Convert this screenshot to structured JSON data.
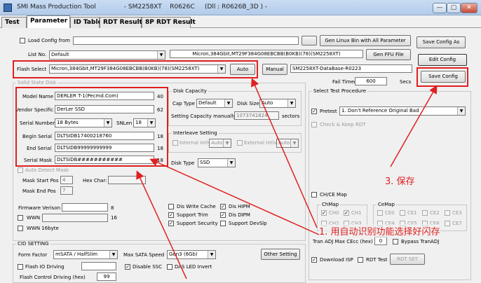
{
  "window": {
    "title": "SMI Mass Production Tool              - SM2258XT    R0626C     (Dll : R0626B_3D ) -",
    "buttons": [
      "—",
      "▢",
      "✕"
    ]
  },
  "tabs": [
    "Test",
    "Parameter",
    "ID Table",
    "RDT Result",
    "8P RDT Result"
  ],
  "top": {
    "load_config_label": "Load Config from",
    "list_no_label": "List No.",
    "list_no_value": "Default",
    "flash_select_label": "Flash Select",
    "flash_select_value": "Micron,384Gbit,MT29F384G08EBCBB(B0KB)(78)(SM2258XT)",
    "flash_info_value": "Micron,384Gbit,MT29F384G08EBCBB(B0KB)(78)(SM2258XT)",
    "auto_btn": "Auto",
    "manual_btn": "Manual",
    "database_value": "SM2258XT-DataBase-R0223",
    "gen_linux_btn": "Gen Linux Bin with All Parameter",
    "gen_ffu_btn": "Gen FFU File",
    "save_config_as_btn": "Save Config As",
    "edit_config_btn": "Edit Config",
    "save_config_btn": "Save Config",
    "fail_timeout_label": "Fail Timeout",
    "fail_timeout_value": "600",
    "secs_label": "Secs"
  },
  "ssd": {
    "group": "Solid State Disk",
    "model_name_label": "Model Name",
    "model_name_value": "DERLER T-1(Pecmd.Com)",
    "model_name_len": "40",
    "vendor_label": "Vendor Specific",
    "vendor_value": "DerLer SSD",
    "vendor_len": "62",
    "serial_number_label": "Serial Number",
    "serial_number_value": "18 Bytes",
    "snlen_label": "SNLen",
    "snlen_value": "18",
    "begin_serial_label": "Begin Serial",
    "begin_serial_value": "DLTSIDB17400218760",
    "begin_serial_len": "18",
    "end_serial_label": "End Serial",
    "end_serial_value": "DLTSIDB99999999999",
    "end_serial_len": "18",
    "serial_mask_label": "Serial Mask",
    "serial_mask_value": "DLTSIDB###########",
    "serial_mask_len": "18",
    "auto_detect_label": "Auto Detect Mask",
    "mask_start_label": "Mask Start Pos",
    "mask_start_value": "4",
    "mask_end_label": "Mask End Pos",
    "mask_end_value": "7",
    "hex_char_label": "Hex Char:",
    "fw_version_label": "Firmware Verison",
    "fw_version_len": "8",
    "wwn_label": "WWN",
    "wwn_len": "16",
    "wwn16_label": "WWN 16byte"
  },
  "disk": {
    "group": "Disk Capacity",
    "cap_type_label": "Cap Type",
    "cap_type_value": "Default",
    "disk_size_label": "Disk Size",
    "disk_size_value": "Auto",
    "setting_cap_label": "Setting Capacity manually",
    "setting_cap_value": "1073741824",
    "sectors_label": "sectors",
    "interleave_group": "Interleave Setting",
    "internal_label": "Internal Intlv",
    "internal_value": "Auto",
    "external_label": "External Intlv",
    "external_value": "Auto",
    "disk_type_label": "Disk Type",
    "disk_type_value": "SSD",
    "dis_write_cache": "Dis Write Cache",
    "dis_hipm": "Dis HIPM",
    "support_trim": "Support Trim",
    "dis_dipm": "Dis DIPM",
    "support_security": "Support Security",
    "support_devslp": "Support DevSlp"
  },
  "cid": {
    "group": "CID SETTING",
    "form_factor_label": "Form Factor",
    "form_factor_value": "mSATA / HalfSlim",
    "max_sata_label": "Max SATA Speed",
    "max_sata_value": "Gen3 (6Gb)",
    "other_setting_btn": "Other Setting",
    "flash_io_label": "Flash IO Driving",
    "disable_ssc_label": "Disable SSC",
    "das_led_label": "DAS LED Invert",
    "flash_ctrl_label": "Flash Control Driving (hex)",
    "flash_ctrl_value": "99"
  },
  "right": {
    "group": "Select Test Procedure",
    "pretest_label": "Pretest",
    "pretest_value": "1. Don't Reference Original Bad",
    "check_keep_label": "Check & Keep RDT",
    "chce_label": "CH/CE Map",
    "chmap_group": "ChMap",
    "chmap": [
      "CH0",
      "CH1",
      "CH2",
      "CH3"
    ],
    "cemap_group": "CeMap",
    "cemap": [
      "CE0",
      "CE1",
      "CE2",
      "CE3",
      "CE4",
      "CE5",
      "CE6",
      "CE7"
    ],
    "tran_adj_label": "Tran ADJ Max CEcc (hex)",
    "tran_adj_value": "0",
    "bypass_label": "Bypass TranADJ",
    "download_isp_label": "Download ISP",
    "rdt_test_label": "RDT Test",
    "rdt_set_btn": "RDT SET"
  },
  "annotations": {
    "step1": "1. 用自动识别功能选择好闪存",
    "step3": "3. 保存"
  },
  "colors": {
    "annotation": "#e02020"
  }
}
